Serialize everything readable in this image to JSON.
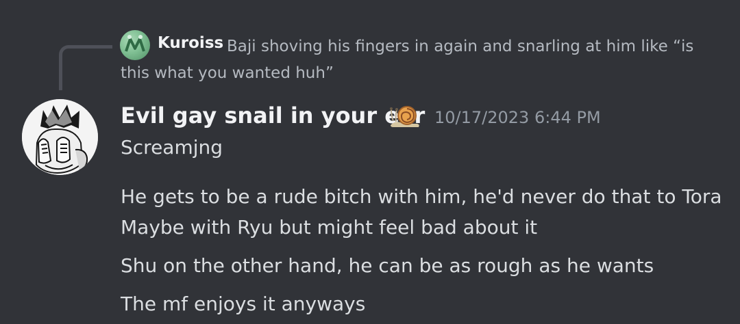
{
  "reply": {
    "username": "Kuroiss",
    "text": "Baji shoving his fingers in again and snarling at him like “is this what you wanted huh”"
  },
  "message": {
    "author": "Evil gay snail in your ear",
    "author_emoji": "snail-icon",
    "timestamp": "10/17/2023 6:44 PM",
    "lines": [
      "Screamjng",
      "He gets to be a rude bitch with him, he'd never do that to Tora",
      "Maybe with Ryu but might feel bad about it",
      "Shu on the other hand, he can be as rough as he wants",
      "The mf enjoys it anyways"
    ]
  },
  "colors": {
    "background": "#313338",
    "text": "#dbdee1",
    "muted": "#949ba4",
    "reply_text": "#b5bac1"
  }
}
